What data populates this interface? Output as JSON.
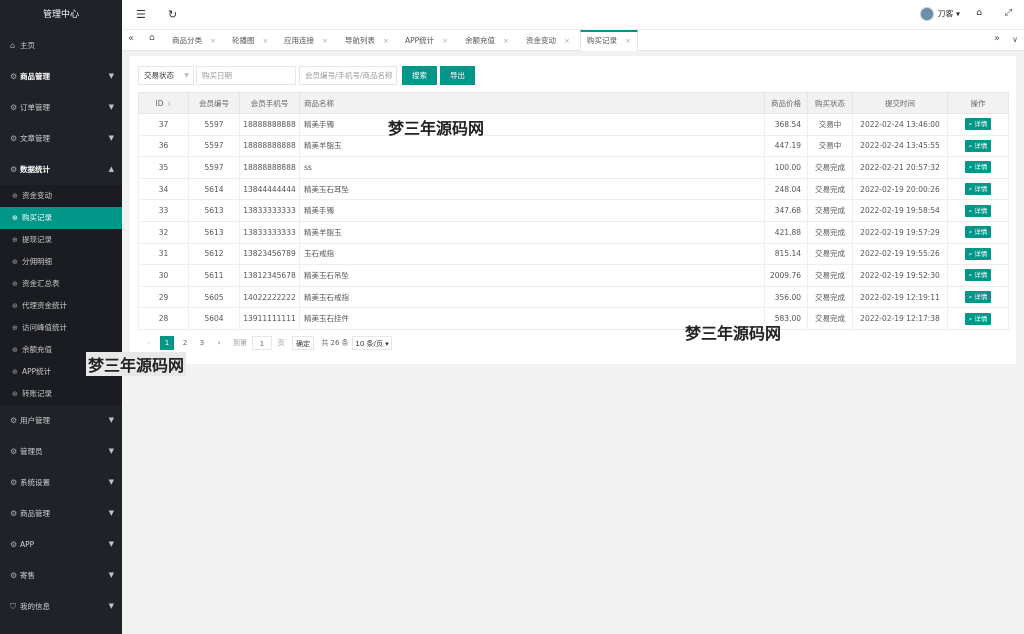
{
  "sidebar": {
    "title": "管理中心",
    "items": [
      {
        "label": "主页",
        "icon": "home-icon"
      },
      {
        "label": "商品管理",
        "icon": "gear-icon",
        "arrow": "▼"
      },
      {
        "label": "订单管理",
        "icon": "gear-icon",
        "arrow": "▼"
      },
      {
        "label": "文章管理",
        "icon": "gear-icon",
        "arrow": "▼"
      },
      {
        "label": "数据统计",
        "icon": "gear-icon",
        "arrow": "▲"
      }
    ],
    "subitems": [
      "资金变动",
      "购买记录",
      "提现记录",
      "分佣明细",
      "资金汇总表",
      "代理资金统计",
      "访问峰值统计",
      "余额充值",
      "APP统计",
      "转账记录"
    ],
    "items_after": [
      {
        "label": "用户管理",
        "icon": "gear-icon",
        "arrow": "▼"
      },
      {
        "label": "管理员",
        "icon": "gear-icon",
        "arrow": "▼"
      },
      {
        "label": "系统设置",
        "icon": "gear-icon",
        "arrow": "▼"
      },
      {
        "label": "商品管理",
        "icon": "gear-icon",
        "arrow": "▼"
      },
      {
        "label": "APP",
        "icon": "gear-icon",
        "arrow": "▼"
      },
      {
        "label": "寄售",
        "icon": "gear-icon",
        "arrow": "▼"
      },
      {
        "label": "我的信息",
        "icon": "shield-icon",
        "arrow": "▼"
      }
    ]
  },
  "topbar": {
    "menu_icon": "☰",
    "refresh_icon": "↻",
    "username": "刀客",
    "user_caret": "▾",
    "tag_icon": "⌂",
    "fullscreen_icon": "⤢"
  },
  "tabs": {
    "prev": "«",
    "home": "⌂",
    "items": [
      "商品分类",
      "轮播图",
      "应用连接",
      "导航列表",
      "APP统计",
      "余额充值",
      "资金变动"
    ],
    "active": "购买记录",
    "close": "×",
    "next": "»",
    "more": "∨"
  },
  "filters": {
    "status_label": "交易状态",
    "date_placeholder": "购买日期",
    "keyword_placeholder": "会员编号/手机号/商品名称",
    "search_label": "搜索",
    "export_label": "导出"
  },
  "table": {
    "headers": [
      "ID",
      "会员编号",
      "会员手机号",
      "商品名称",
      "商品价格",
      "购买状态",
      "提交时间",
      "操作"
    ],
    "detail_label": "详情",
    "detail_icon": "🔍",
    "rows": [
      {
        "id": "37",
        "member": "5597",
        "phone": "18888888888",
        "name": "精美手镯",
        "price": "368.54",
        "status": "交易中",
        "time": "2022-02-24 13:46:00"
      },
      {
        "id": "36",
        "member": "5597",
        "phone": "18888888888",
        "name": "精美羊脂玉",
        "price": "447.19",
        "status": "交易中",
        "time": "2022-02-24 13:45:55"
      },
      {
        "id": "35",
        "member": "5597",
        "phone": "18888888888",
        "name": "ss",
        "price": "100.00",
        "status": "交易完成",
        "time": "2022-02-21 20:57:32"
      },
      {
        "id": "34",
        "member": "5614",
        "phone": "13844444444",
        "name": "精美玉石耳坠",
        "price": "248.04",
        "status": "交易完成",
        "time": "2022-02-19 20:00:26"
      },
      {
        "id": "33",
        "member": "5613",
        "phone": "13833333333",
        "name": "精美手镯",
        "price": "347.68",
        "status": "交易完成",
        "time": "2022-02-19 19:58:54"
      },
      {
        "id": "32",
        "member": "5613",
        "phone": "13833333333",
        "name": "精美羊脂玉",
        "price": "421.88",
        "status": "交易完成",
        "time": "2022-02-19 19:57:29"
      },
      {
        "id": "31",
        "member": "5612",
        "phone": "13823456789",
        "name": "玉石戒指",
        "price": "815.14",
        "status": "交易完成",
        "time": "2022-02-19 19:55:26"
      },
      {
        "id": "30",
        "member": "5611",
        "phone": "13812345678",
        "name": "精美玉石吊坠",
        "price": "2009.76",
        "status": "交易完成",
        "time": "2022-02-19 19:52:30"
      },
      {
        "id": "29",
        "member": "5605",
        "phone": "14022222222",
        "name": "精美玉石戒指",
        "price": "356.00",
        "status": "交易完成",
        "time": "2022-02-19 12:19:11"
      },
      {
        "id": "28",
        "member": "5604",
        "phone": "13911111111",
        "name": "精美玉石挂件",
        "price": "583.00",
        "status": "交易完成",
        "time": "2022-02-19 12:17:38"
      }
    ]
  },
  "pager": {
    "prev": "‹",
    "pages": [
      "1",
      "2",
      "3"
    ],
    "next": "›",
    "goto_label": "到第",
    "goto_value": "1",
    "page_unit": "页",
    "confirm": "确定",
    "total": "共 26 条",
    "per_page": "10 条/页 ▾"
  },
  "watermarks": [
    "梦三年源码网",
    "梦三年源码网",
    "梦三年源码网"
  ],
  "colors": {
    "accent": "#009688",
    "sidebar_bg": "#20222a"
  }
}
